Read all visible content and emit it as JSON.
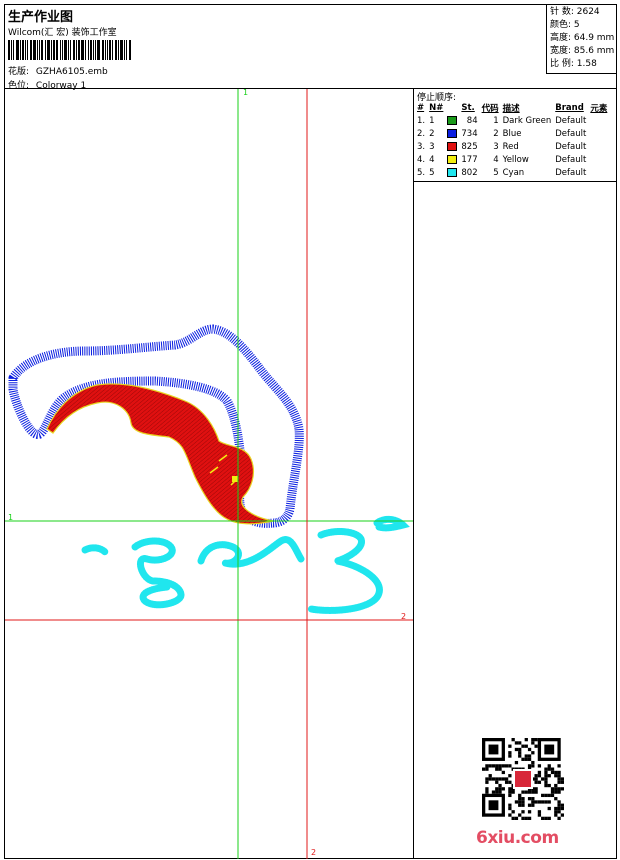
{
  "header": {
    "title": "生产作业图",
    "subtitle": "Wilcom(汇 宏) 装饰工作室",
    "design_label": "花版:",
    "design_file": "GZHA6105.emb",
    "color_label": "色位:",
    "colorway": "Colorway 1"
  },
  "meta": {
    "stitches": "针 数: 2624",
    "colors": "颜色: 5",
    "height": "高度: 64.9 mm",
    "width": "宽度: 85.6 mm",
    "scale": "比 例: 1.58"
  },
  "stops": {
    "title": "停止顺序:",
    "headers": [
      "#",
      "N#",
      "St.",
      "代码",
      "描述",
      "Brand",
      "元素"
    ],
    "rows": [
      {
        "idx": "1.",
        "n": "1",
        "color": "#1a9a1a",
        "st": "84",
        "code": "1",
        "desc": "Dark Green",
        "brand": "Default"
      },
      {
        "idx": "2.",
        "n": "2",
        "color": "#0a1ee0",
        "st": "734",
        "code": "2",
        "desc": "Blue",
        "brand": "Default"
      },
      {
        "idx": "3.",
        "n": "3",
        "color": "#e01010",
        "st": "825",
        "code": "3",
        "desc": "Red",
        "brand": "Default"
      },
      {
        "idx": "4.",
        "n": "4",
        "color": "#f2ee10",
        "st": "177",
        "code": "4",
        "desc": "Yellow",
        "brand": "Default"
      },
      {
        "idx": "5.",
        "n": "5",
        "color": "#20e6ee",
        "st": "802",
        "code": "5",
        "desc": "Cyan",
        "brand": "Default"
      }
    ]
  },
  "guides": {
    "green_label": "1",
    "red_label": "2",
    "green_color": "#19d019",
    "red_color": "#e01818"
  },
  "watermark": {
    "logo": "6xiu.com"
  }
}
